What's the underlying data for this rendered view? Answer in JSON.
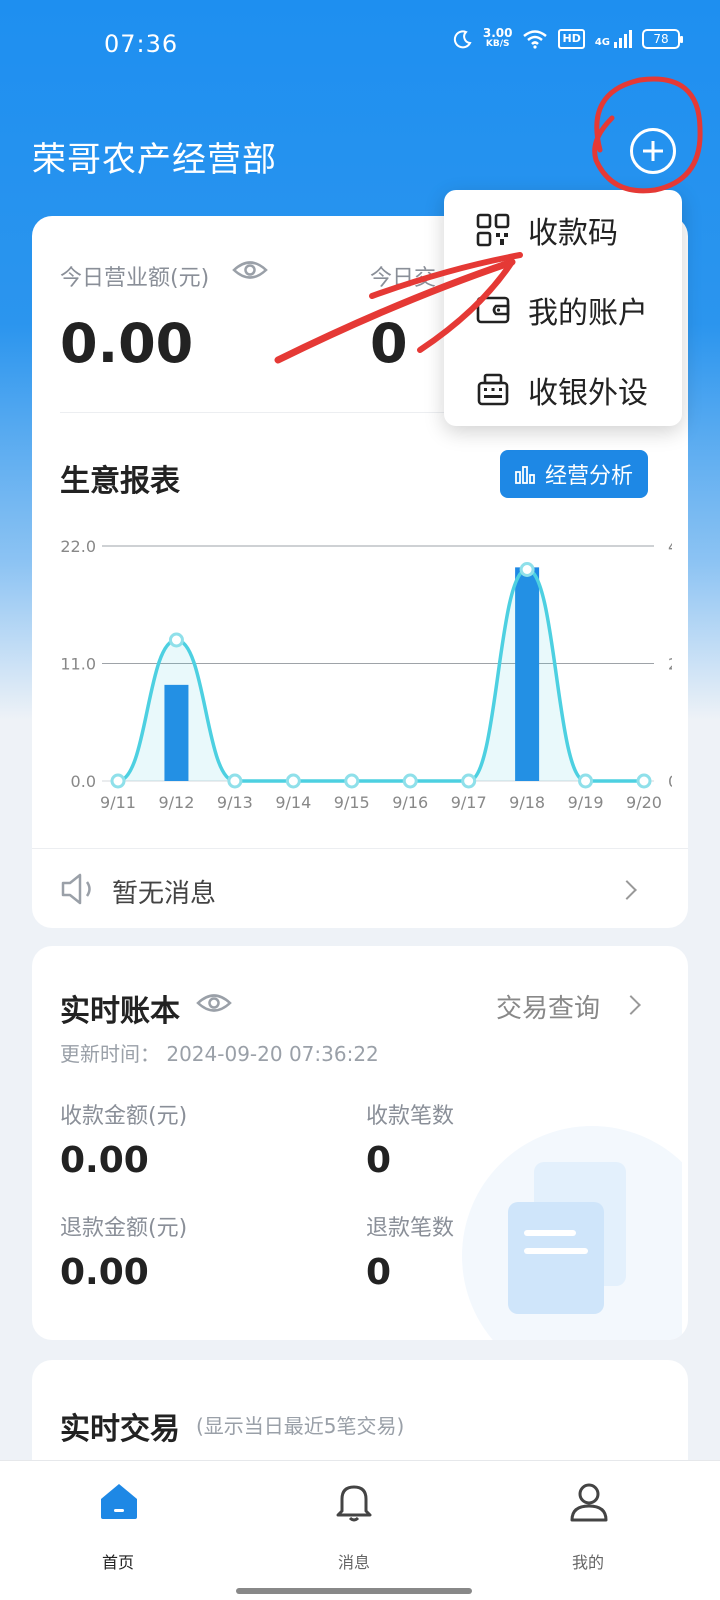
{
  "status_bar": {
    "time": "07:36",
    "net_speed_value": "3.00",
    "net_speed_unit": "KB/S",
    "hd": "HD",
    "network": "4G",
    "battery": "78"
  },
  "header": {
    "title": "荣哥农产经营部",
    "add_icon": "plus-circle-icon"
  },
  "dropdown": {
    "items": [
      {
        "label": "收款码",
        "icon": "qr-code-icon"
      },
      {
        "label": "我的账户",
        "icon": "wallet-icon"
      },
      {
        "label": "收银外设",
        "icon": "cash-register-icon"
      }
    ]
  },
  "today": {
    "revenue_label": "今日营业额(元)",
    "revenue_value": "0.00",
    "count_label": "今日交",
    "count_value": "0"
  },
  "report": {
    "title": "生意报表",
    "analysis_button": "经营分析"
  },
  "chart_data": {
    "type": "bar",
    "categories": [
      "9/11",
      "9/12",
      "9/13",
      "9/14",
      "9/15",
      "9/16",
      "9/17",
      "9/18",
      "9/19",
      "9/20"
    ],
    "series": [
      {
        "values": [
          0,
          9,
          0,
          0,
          0,
          0,
          0,
          20,
          0,
          0
        ],
        "axis": "left",
        "type": "bar",
        "color": "#1e88e5"
      },
      {
        "values": [
          0,
          2.4,
          0,
          0,
          0,
          0,
          0,
          3.6,
          0,
          0
        ],
        "axis": "right",
        "type": "line",
        "color": "#4dd0e1"
      }
    ],
    "ylim": [
      0,
      22
    ],
    "y_ticks": [
      "22.0",
      "11.0",
      "0.0"
    ],
    "y2lim": [
      0,
      4
    ],
    "y2_ticks": [
      "4",
      "2",
      "0"
    ],
    "grid": true
  },
  "notice": {
    "text": "暂无消息",
    "icon": "speaker-icon"
  },
  "ledger": {
    "title": "实时账本",
    "query_link": "交易查询",
    "update_time": "更新时间： 2024-09-20 07:36:22",
    "collect_amount_label": "收款金额(元)",
    "collect_amount": "0.00",
    "collect_count_label": "收款笔数",
    "collect_count": "0",
    "refund_amount_label": "退款金额(元)",
    "refund_amount": "0.00",
    "refund_count_label": "退款笔数",
    "refund_count": "0"
  },
  "transactions": {
    "title": "实时交易",
    "subtitle": "(显示当日最近5笔交易)"
  },
  "bottom_nav": {
    "items": [
      {
        "label": "首页",
        "icon": "home-icon",
        "active": true
      },
      {
        "label": "消息",
        "icon": "bell-icon",
        "active": false
      },
      {
        "label": "我的",
        "icon": "user-icon",
        "active": false
      }
    ]
  },
  "colors": {
    "primary": "#1e88e5",
    "line": "#4dd0e1",
    "annotation": "#e53935"
  }
}
